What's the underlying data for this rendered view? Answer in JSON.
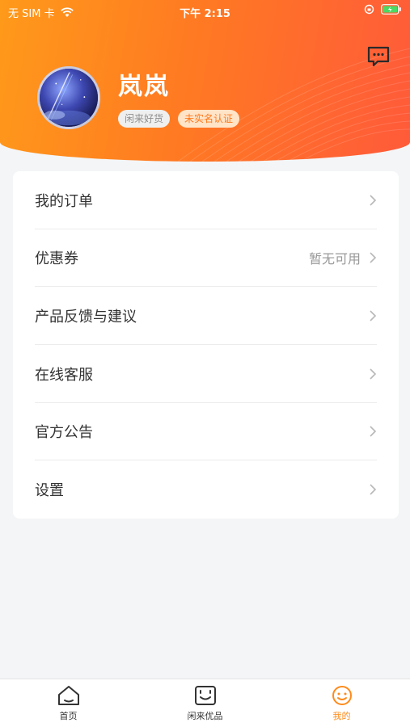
{
  "status_bar": {
    "carrier": "无 SIM 卡",
    "time": "下午 2:15"
  },
  "header": {
    "username": "岚岚",
    "tags": [
      "闲来好货",
      "未实名认证"
    ],
    "message_icon": "message-icon"
  },
  "menu": {
    "items": [
      {
        "label": "我的订单",
        "note": ""
      },
      {
        "label": "优惠券",
        "note": "暂无可用"
      },
      {
        "label": "产品反馈与建议",
        "note": ""
      },
      {
        "label": "在线客服",
        "note": ""
      },
      {
        "label": "官方公告",
        "note": ""
      },
      {
        "label": "设置",
        "note": ""
      }
    ]
  },
  "tabbar": {
    "tabs": [
      {
        "label": "首页",
        "icon": "home-icon"
      },
      {
        "label": "闲来优品",
        "icon": "smile-box-icon"
      },
      {
        "label": "我的",
        "icon": "profile-face-icon"
      }
    ],
    "active_index": 2
  },
  "colors": {
    "brand_orange": "#ff8a1a",
    "header_start": "#ff9a1a",
    "header_end": "#ff5a3a"
  }
}
